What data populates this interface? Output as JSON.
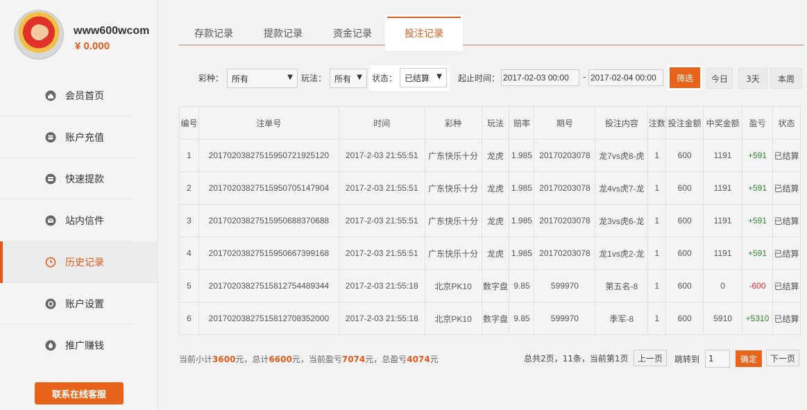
{
  "profile": {
    "username": "www600wcom",
    "balance": "¥ 0.000"
  },
  "menu": [
    {
      "label": "会员首页",
      "icon": "home-icon"
    },
    {
      "label": "账户充值",
      "icon": "deposit-icon"
    },
    {
      "label": "快速提款",
      "icon": "withdraw-icon"
    },
    {
      "label": "站内信件",
      "icon": "mail-icon"
    },
    {
      "label": "历史记录",
      "icon": "clock-icon"
    },
    {
      "label": "账户设置",
      "icon": "gear-icon"
    },
    {
      "label": "推广赚钱",
      "icon": "money-icon"
    }
  ],
  "support_button": "联系在线客服",
  "tabs": [
    "存款记录",
    "提款记录",
    "资金记录",
    "投注记录"
  ],
  "filters": {
    "lottery_label": "彩种：",
    "lottery_value": "所有",
    "play_label": "玩法：",
    "play_value": "所有",
    "status_label": "状态：",
    "status_value": "已结算",
    "time_label": "起止时间：",
    "start_time": "2017-02-03 00:00",
    "separator": "-",
    "end_time": "2017-02-04 00:00",
    "filter_button": "筛选",
    "quick": [
      "今日",
      "3天",
      "本周"
    ]
  },
  "table": {
    "headers": [
      "编号",
      "注单号",
      "时间",
      "彩种",
      "玩法",
      "赔率",
      "期号",
      "投注内容",
      "注数",
      "投注金额",
      "中奖金额",
      "盈亏",
      "状态"
    ],
    "rows": [
      [
        "1",
        "20170203827515950721925120",
        "2017-2-03 21:55:51",
        "广东快乐十分",
        "龙虎",
        "1.985",
        "20170203078",
        "龙7vs虎8-虎",
        "1",
        "600",
        "1191",
        "+591",
        "已结算"
      ],
      [
        "2",
        "20170203827515950705147904",
        "2017-2-03 21:55:51",
        "广东快乐十分",
        "龙虎",
        "1.985",
        "20170203078",
        "龙4vs虎7-龙",
        "1",
        "600",
        "1191",
        "+591",
        "已结算"
      ],
      [
        "3",
        "20170203827515950688370688",
        "2017-2-03 21:55:51",
        "广东快乐十分",
        "龙虎",
        "1.985",
        "20170203078",
        "龙3vs虎6-龙",
        "1",
        "600",
        "1191",
        "+591",
        "已结算"
      ],
      [
        "4",
        "20170203827515950667399168",
        "2017-2-03 21:55:51",
        "广东快乐十分",
        "龙虎",
        "1.985",
        "20170203078",
        "龙1vs虎2-龙",
        "1",
        "600",
        "1191",
        "+591",
        "已结算"
      ],
      [
        "5",
        "20170203827515812754489344",
        "2017-2-03 21:55:18",
        "北京PK10",
        "数字盘",
        "9.85",
        "599970",
        "第五名-8",
        "1",
        "600",
        "0",
        "-600",
        "已结算"
      ],
      [
        "6",
        "20170203827515812708352000",
        "2017-2-03 21:55:18",
        "北京PK10",
        "数字盘",
        "9.85",
        "599970",
        "季军-8",
        "1",
        "600",
        "5910",
        "+5310",
        "已结算"
      ]
    ]
  },
  "summary": {
    "t1": "当前小计",
    "subtotal": "3600",
    "t2": "元，总计",
    "total": "6600",
    "t3": "元，当前盈亏",
    "current_pl": "7074",
    "t4": "元，总盈亏",
    "total_pl": "4074",
    "t5": "元"
  },
  "pager": {
    "info": "总共2页，11条，当前第1页",
    "prev": "上一页",
    "jump_label": "跳转到",
    "page_value": "1",
    "confirm": "确定",
    "next": "下一页"
  },
  "colors": {
    "accent": "#e35a1a",
    "positive": "#2f8a2f",
    "negative": "#d92e2e"
  }
}
